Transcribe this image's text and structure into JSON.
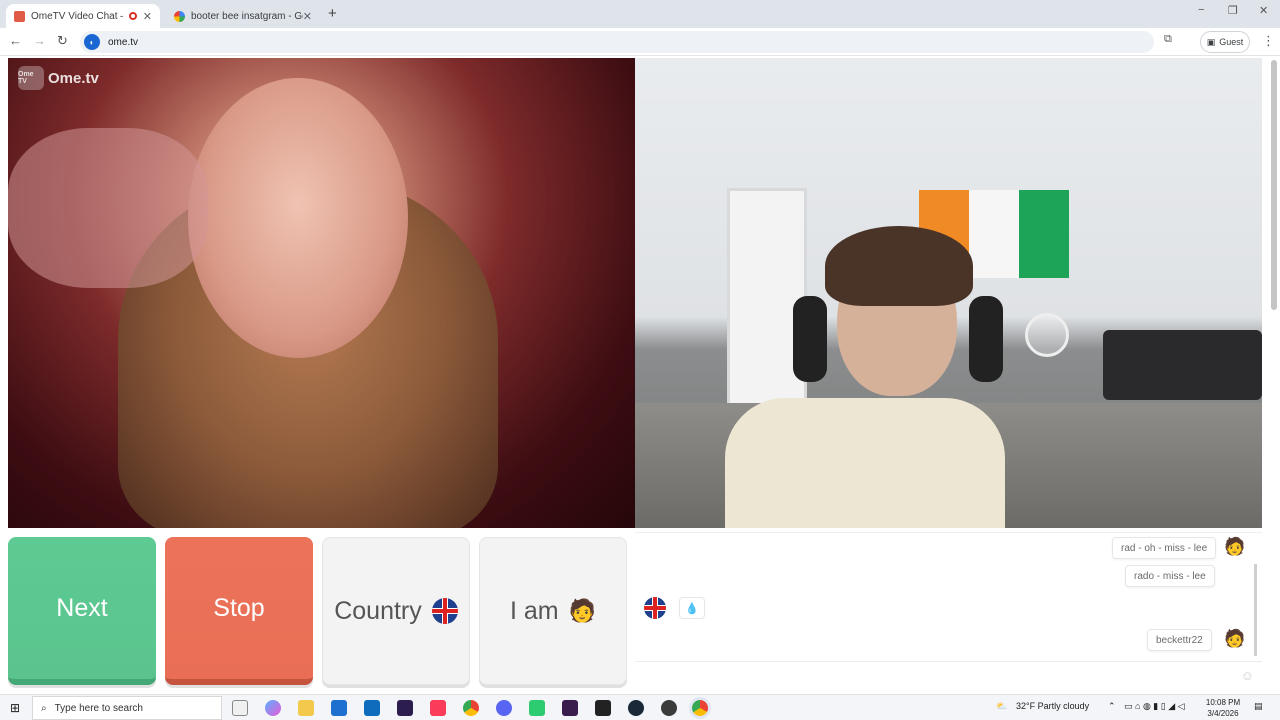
{
  "browser": {
    "tabs": [
      {
        "title": "OmeTV Video Chat — Ome",
        "active": true
      },
      {
        "title": "booter bee insatgram - Google",
        "active": false
      }
    ],
    "new_tab": "+",
    "url": "ome.tv",
    "profile": "Guest",
    "window_controls": {
      "minimize": "−",
      "maximize": "❐",
      "close": "✕"
    }
  },
  "site": {
    "logo_text": "Ome.tv",
    "logo_badge": "Ome TV"
  },
  "controls": {
    "next_label": "Next",
    "stop_label": "Stop",
    "country_label": "Country",
    "iam_label": "I am",
    "country_flag": "uk-flag-icon",
    "iam_icon": "red-haired-boy-icon"
  },
  "chat": {
    "messages": [
      {
        "text": "rad - oh - miss - lee",
        "avatar": true
      },
      {
        "text": "rado - miss - lee",
        "avatar": false
      },
      {
        "text": "beckettr22",
        "avatar": true
      }
    ],
    "partner_flag": "uk-flag-icon",
    "partner_emoji": "💧"
  },
  "taskbar": {
    "search_placeholder": "Type here to search",
    "weather": "32°F  Partly cloudy",
    "time": "10:08 PM",
    "date": "3/4/2026"
  },
  "colors": {
    "next": "#5bc48e",
    "stop": "#e96e55",
    "neutral_button": "#f3f3f3"
  }
}
